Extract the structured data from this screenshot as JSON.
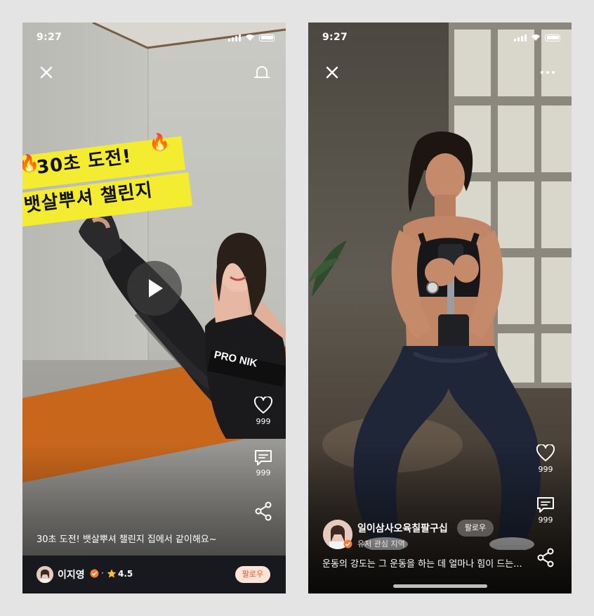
{
  "left_screen": {
    "status": {
      "time": "9:27"
    },
    "banner": {
      "line1": "30초 도전!",
      "line2": "뱃살뿌셔 챌린지",
      "emoji": "🔥"
    },
    "actions": {
      "like_count": "999",
      "comment_count": "999"
    },
    "caption": "30초 도전! 뱃살뿌셔 챌린지 집에서 같이해요~",
    "user": {
      "name": "이지영",
      "separator": "·",
      "rating": "4.5",
      "follow_label": "팔로우"
    },
    "colors": {
      "banner": "#f3ec30",
      "mat": "#c8661c",
      "userbar": "#17191f",
      "follow_bg": "#fde3d8",
      "follow_text": "#e05a2b"
    }
  },
  "right_screen": {
    "status": {
      "time": "9:27"
    },
    "actions": {
      "like_count": "999",
      "comment_count": "999"
    },
    "user": {
      "name": "일이삼사오육칠팔구십",
      "follow_label": "팔로우",
      "subtitle": "유저 관심 지역"
    },
    "caption": "운동의 강도는 그 운동을 하는 데 얼마나 힘이 드는...",
    "colors": {
      "follow_bg": "rgba(255,255,255,0.28)"
    }
  },
  "icons": [
    "close-icon",
    "bell-icon",
    "more-icon",
    "play-icon",
    "heart-icon",
    "comment-icon",
    "share-icon",
    "verified-badge-icon",
    "star-icon",
    "signal-icon",
    "wifi-icon",
    "battery-icon"
  ]
}
